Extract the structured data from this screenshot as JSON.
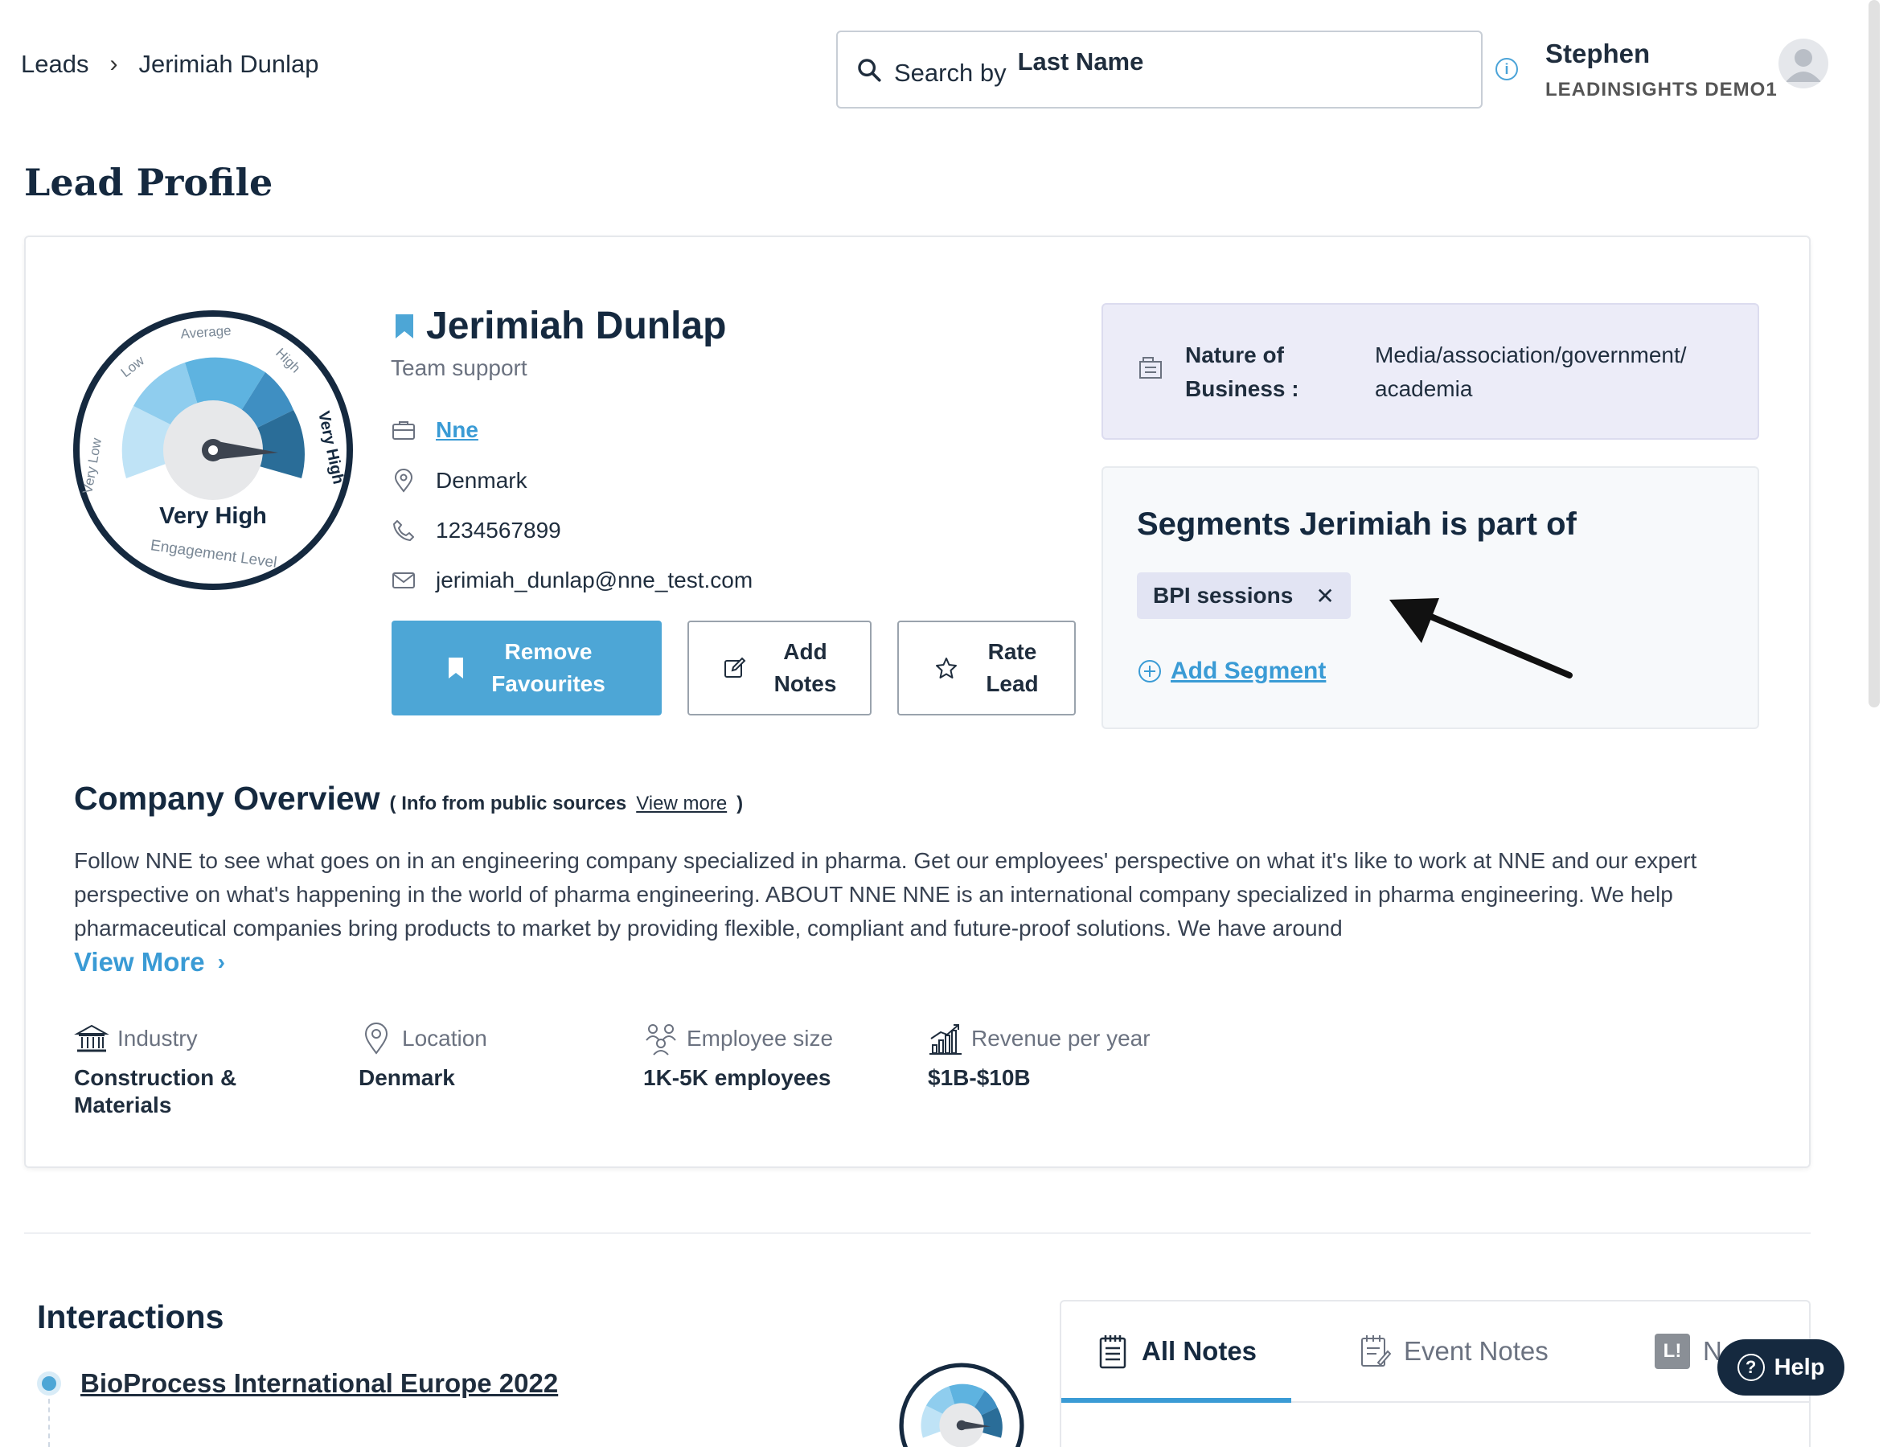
{
  "breadcrumb": {
    "root": "Leads",
    "separator": ">",
    "current": "Jerimiah Dunlap"
  },
  "search": {
    "label": "Search by",
    "value": "Last Name"
  },
  "user": {
    "name": "Stephen",
    "org": "LEADINSIGHTS DEMO1"
  },
  "page": {
    "title": "Lead Profile"
  },
  "gauge": {
    "level": "Very High",
    "caption": "Engagement Level",
    "bands": [
      "Very Low",
      "Low",
      "Average",
      "High",
      "Very High"
    ]
  },
  "lead": {
    "name": "Jerimiah Dunlap",
    "role": "Team support",
    "company": "Nne",
    "location": "Denmark",
    "phone": "1234567899",
    "email": "jerimiah_dunlap@nne_test.com"
  },
  "actions": {
    "favourite_line1": "Remove",
    "favourite_line2": "Favourites",
    "notes_line1": "Add",
    "notes_line2": "Notes",
    "rate_line1": "Rate",
    "rate_line2": "Lead"
  },
  "business": {
    "label_line1": "Nature of",
    "label_line2": "Business :",
    "value": "Media/association/government/ academia"
  },
  "segments": {
    "title": "Segments Jerimiah is part of",
    "items": [
      {
        "label": "BPI sessions",
        "remove": "✕"
      }
    ],
    "add_label": "Add Segment"
  },
  "company_overview": {
    "title": "Company Overview",
    "source_prefix": "( Info from public sources",
    "source_link": "View more",
    "source_suffix": ")",
    "description": "Follow NNE to see what goes on in an engineering company specialized in pharma. Get our employees' perspective on what it's like to work at NNE and our expert perspective on what's happening in the world of pharma engineering. ABOUT NNE NNE is an international company specialized in pharma engineering. We help pharmaceutical companies bring products to market by providing flexible, compliant and future-proof solutions. We have around",
    "view_more": "View More"
  },
  "stats": [
    {
      "label": "Industry",
      "value": "Construction & Materials",
      "icon": "bank-icon"
    },
    {
      "label": "Location",
      "value": "Denmark",
      "icon": "location-pin-icon"
    },
    {
      "label": "Employee size",
      "value": "1K-5K employees",
      "icon": "people-icon"
    },
    {
      "label": "Revenue per year",
      "value": "$1B-$10B",
      "icon": "revenue-chart-icon"
    }
  ],
  "interactions": {
    "title": "Interactions",
    "events": [
      {
        "name": "BioProcess International Europe 2022"
      }
    ]
  },
  "notes_tabs": [
    {
      "label": "All Notes",
      "active": true
    },
    {
      "label": "Event Notes",
      "active": false
    },
    {
      "label": "N",
      "active": false
    }
  ],
  "help": {
    "label": "Help"
  },
  "colors": {
    "primary": "#4da6d6",
    "navy": "#15293f",
    "nob_bg": "#ececf8"
  }
}
